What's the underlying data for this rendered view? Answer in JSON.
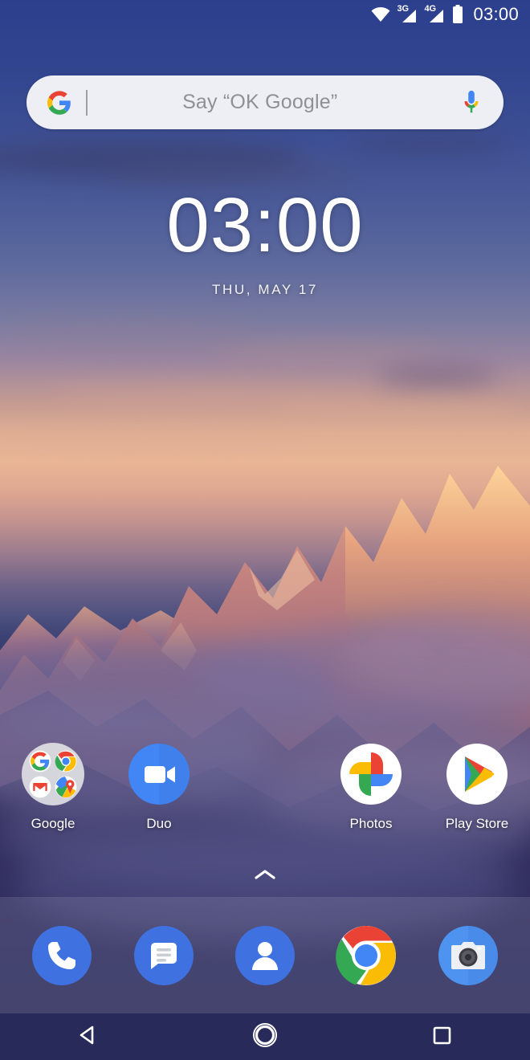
{
  "status_bar": {
    "time": "03:00",
    "icons": [
      {
        "name": "wifi-icon",
        "label": ""
      },
      {
        "name": "signal-3g-icon",
        "label": "3G"
      },
      {
        "name": "signal-4g-icon",
        "label": "4G"
      },
      {
        "name": "battery-icon",
        "label": ""
      }
    ]
  },
  "search": {
    "placeholder": "Say “OK Google”",
    "logo": "google-g-logo",
    "mic": "microphone-icon"
  },
  "clock": {
    "time": "03:00",
    "date": "THU, MAY 17"
  },
  "apps": [
    {
      "label": "Google",
      "icon": "google-folder-icon"
    },
    {
      "label": "Duo",
      "icon": "duo-icon"
    },
    {
      "label": "",
      "icon": ""
    },
    {
      "label": "Photos",
      "icon": "photos-icon"
    },
    {
      "label": "Play Store",
      "icon": "play-store-icon"
    }
  ],
  "drawer_handle": {
    "icon": "chevron-up-icon"
  },
  "dock": [
    {
      "name": "phone",
      "icon": "phone-icon"
    },
    {
      "name": "messages",
      "icon": "messages-icon"
    },
    {
      "name": "contacts",
      "icon": "contacts-icon"
    },
    {
      "name": "chrome",
      "icon": "chrome-icon"
    },
    {
      "name": "camera",
      "icon": "camera-icon"
    }
  ],
  "nav_bar": [
    {
      "name": "back",
      "icon": "back-triangle-icon"
    },
    {
      "name": "home",
      "icon": "home-circle-icon"
    },
    {
      "name": "recents",
      "icon": "recents-square-icon"
    }
  ],
  "colors": {
    "google_blue": "#4285F4",
    "google_red": "#EA4335",
    "google_yellow": "#FBBC05",
    "google_green": "#34A853",
    "search_bar_bg": "#EDEFF4",
    "wallpaper_top": "#2C3F8D"
  }
}
